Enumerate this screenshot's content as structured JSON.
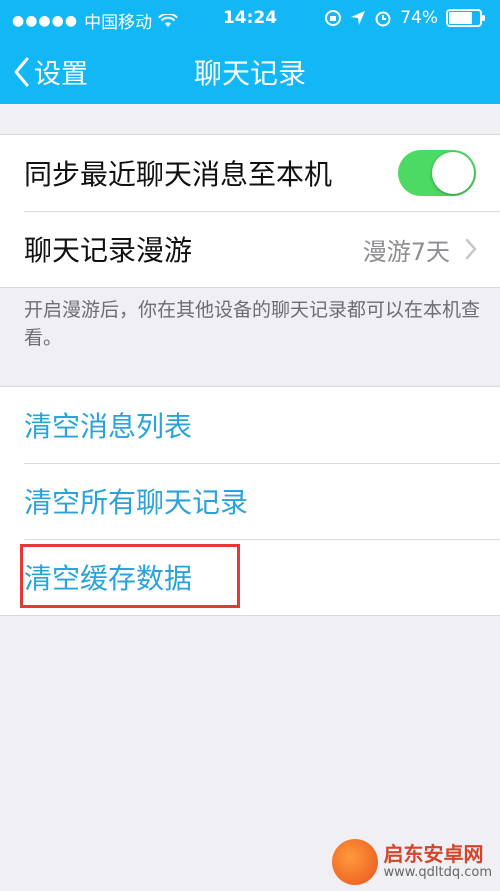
{
  "status_bar": {
    "signal_dots": "●●●●●",
    "carrier": "中国移动",
    "time": "14:24",
    "battery": "74%"
  },
  "nav": {
    "back_label": "设置",
    "title": "聊天记录"
  },
  "settings": {
    "sync_label": "同步最近聊天消息至本机",
    "sync_enabled": true,
    "roaming_label": "聊天记录漫游",
    "roaming_value": "漫游7天",
    "hint": "开启漫游后，你在其他设备的聊天记录都可以在本机查看。"
  },
  "actions": {
    "clear_messages": "清空消息列表",
    "clear_all_history": "清空所有聊天记录",
    "clear_cache": "清空缓存数据"
  },
  "colors": {
    "accent": "#12b7f5",
    "toggle_on": "#4cd964",
    "action_text": "#2aa3d9",
    "highlight": "#e53935"
  },
  "watermark": {
    "title": "启东安卓网",
    "url": "www.qdltdq.com"
  }
}
